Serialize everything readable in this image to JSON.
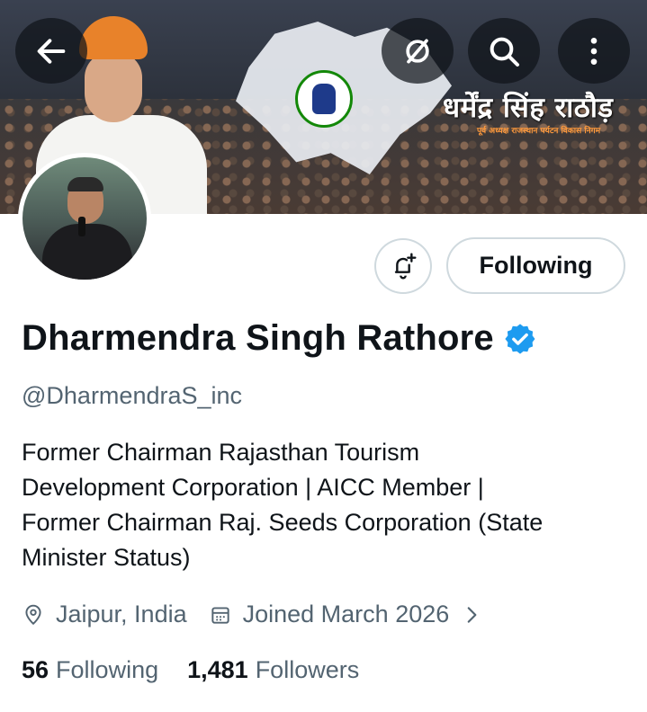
{
  "banner": {
    "title_text": "धर्मेंद्र सिंह राठौड़",
    "subtitle_text": "पूर्व अध्यक्ष राजस्थान पर्यटन विकास निगम"
  },
  "header_icons": {
    "back": "arrow-left-icon",
    "mute": "slashed-circle-icon",
    "search": "search-icon",
    "more": "more-vertical-icon"
  },
  "actions": {
    "notify_icon": "bell-plus-icon",
    "following_label": "Following"
  },
  "profile": {
    "name": "Dharmendra Singh Rathore",
    "handle": "@DharmendraS_inc",
    "bio_lines": [
      "Former Chairman Rajasthan Tourism",
      "Development Corporation | AICC Member |",
      "Former Chairman Raj. Seeds Corporation (State",
      "Minister Status)"
    ],
    "location": "Jaipur, India",
    "joined": "Joined March 2026",
    "following_count": "56",
    "following_label": "Following",
    "followers_count": "1,481",
    "followers_label": "Followers"
  },
  "colors": {
    "verified_blue": "#1d9bf0",
    "secondary_text": "#536471",
    "primary_text": "#0f1419",
    "border": "#cfd9de"
  }
}
